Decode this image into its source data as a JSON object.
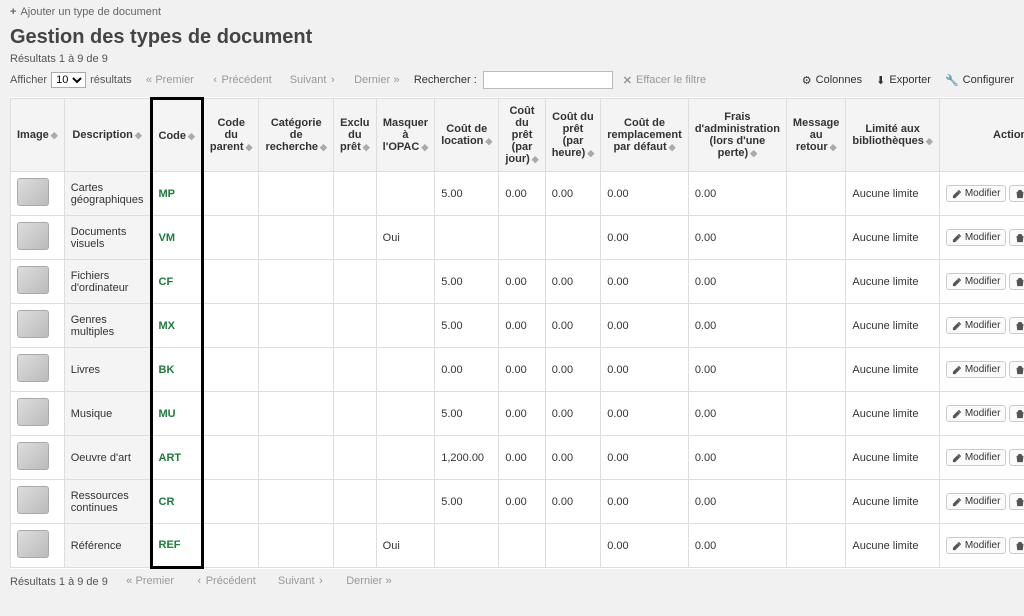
{
  "header": {
    "add_link": "Ajouter un type de document",
    "title": "Gestion des types de document"
  },
  "results_summary": "Résultats 1 à 9 de 9",
  "toolbar": {
    "show_prefix": "Afficher",
    "show_suffix": "résultats",
    "page_len_value": "10",
    "first": "Premier",
    "prev": "Précédent",
    "next": "Suivant",
    "last": "Dernier",
    "search_label": "Rechercher :",
    "clear_filter": "Effacer le filtre",
    "columns": "Colonnes",
    "export": "Exporter",
    "configure": "Configurer"
  },
  "columns": {
    "image": "Image",
    "description": "Description",
    "code": "Code",
    "parent_code": "Code du parent",
    "search_category": "Catégorie de recherche",
    "not_for_loan": "Exclu du prêt",
    "hide_opac": "Masquer à l'OPAC",
    "rental_charge": "Coût de location",
    "daily_cost": "Coût du prêt (par jour)",
    "hourly_cost": "Coût du prêt (par heure)",
    "replacement_cost": "Coût de remplacement par défaut",
    "processing_fee": "Frais d'administration (lors d'une perte)",
    "checkin_msg": "Message au retour",
    "library_limit": "Limité aux bibliothèques",
    "actions": "Actions"
  },
  "action_labels": {
    "edit": "Modifier",
    "delete": "Supprimer"
  },
  "rows": [
    {
      "description": "Cartes géographiques",
      "code": "MP",
      "parent_code": "",
      "search_category": "",
      "not_for_loan": "",
      "hide_opac": "",
      "rental": "5.00",
      "daily": "0.00",
      "hourly": "0.00",
      "replacement": "0.00",
      "processing": "0.00",
      "checkin_msg": "",
      "library_limit": "Aucune limite"
    },
    {
      "description": "Documents visuels",
      "code": "VM",
      "parent_code": "",
      "search_category": "",
      "not_for_loan": "",
      "hide_opac": "Oui",
      "rental": "",
      "daily": "",
      "hourly": "",
      "replacement": "0.00",
      "processing": "0.00",
      "checkin_msg": "",
      "library_limit": "Aucune limite"
    },
    {
      "description": "Fichiers d'ordinateur",
      "code": "CF",
      "parent_code": "",
      "search_category": "",
      "not_for_loan": "",
      "hide_opac": "",
      "rental": "5.00",
      "daily": "0.00",
      "hourly": "0.00",
      "replacement": "0.00",
      "processing": "0.00",
      "checkin_msg": "",
      "library_limit": "Aucune limite"
    },
    {
      "description": "Genres multiples",
      "code": "MX",
      "parent_code": "",
      "search_category": "",
      "not_for_loan": "",
      "hide_opac": "",
      "rental": "5.00",
      "daily": "0.00",
      "hourly": "0.00",
      "replacement": "0.00",
      "processing": "0.00",
      "checkin_msg": "",
      "library_limit": "Aucune limite"
    },
    {
      "description": "Livres",
      "code": "BK",
      "parent_code": "",
      "search_category": "",
      "not_for_loan": "",
      "hide_opac": "",
      "rental": "0.00",
      "daily": "0.00",
      "hourly": "0.00",
      "replacement": "0.00",
      "processing": "0.00",
      "checkin_msg": "",
      "library_limit": "Aucune limite"
    },
    {
      "description": "Musique",
      "code": "MU",
      "parent_code": "",
      "search_category": "",
      "not_for_loan": "",
      "hide_opac": "",
      "rental": "5.00",
      "daily": "0.00",
      "hourly": "0.00",
      "replacement": "0.00",
      "processing": "0.00",
      "checkin_msg": "",
      "library_limit": "Aucune limite"
    },
    {
      "description": "Oeuvre d'art",
      "code": "ART",
      "parent_code": "",
      "search_category": "",
      "not_for_loan": "",
      "hide_opac": "",
      "rental": "1,200.00",
      "daily": "0.00",
      "hourly": "0.00",
      "replacement": "0.00",
      "processing": "0.00",
      "checkin_msg": "",
      "library_limit": "Aucune limite"
    },
    {
      "description": "Ressources continues",
      "code": "CR",
      "parent_code": "",
      "search_category": "",
      "not_for_loan": "",
      "hide_opac": "",
      "rental": "5.00",
      "daily": "0.00",
      "hourly": "0.00",
      "replacement": "0.00",
      "processing": "0.00",
      "checkin_msg": "",
      "library_limit": "Aucune limite"
    },
    {
      "description": "Référence",
      "code": "REF",
      "parent_code": "",
      "search_category": "",
      "not_for_loan": "",
      "hide_opac": "Oui",
      "rental": "",
      "daily": "",
      "hourly": "",
      "replacement": "0.00",
      "processing": "0.00",
      "checkin_msg": "",
      "library_limit": "Aucune limite"
    }
  ],
  "bottom_summary": "Résultats 1 à 9 de 9"
}
